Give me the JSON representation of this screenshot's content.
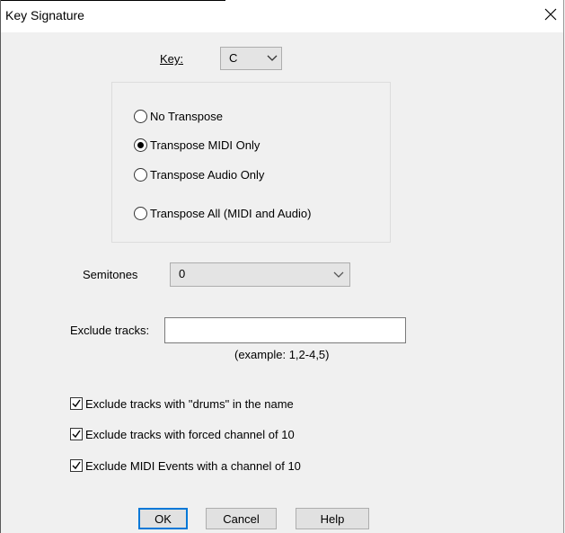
{
  "window": {
    "title": "Key Signature"
  },
  "key": {
    "label": "Key:",
    "value": "C"
  },
  "transpose_options": [
    {
      "label": "No Transpose",
      "selected": false
    },
    {
      "label": "Transpose MIDI Only",
      "selected": true
    },
    {
      "label": "Transpose Audio Only",
      "selected": false
    },
    {
      "label": "Transpose All (MIDI and Audio)",
      "selected": false
    }
  ],
  "semitones": {
    "label": "Semitones",
    "value": "0"
  },
  "exclude_tracks": {
    "label": "Exclude tracks:",
    "value": "",
    "hint": "(example: 1,2-4,5)"
  },
  "checkboxes": [
    {
      "label": "Exclude tracks with \"drums\" in the name",
      "checked": true
    },
    {
      "label": "Exclude tracks with forced channel of 10",
      "checked": true
    },
    {
      "label": "Exclude MIDI Events with a channel of 10",
      "checked": true
    }
  ],
  "buttons": {
    "ok": "OK",
    "cancel": "Cancel",
    "help": "Help"
  },
  "colors": {
    "default_button_border": "#0078d7",
    "dialog_bg": "#f0f0f0"
  }
}
